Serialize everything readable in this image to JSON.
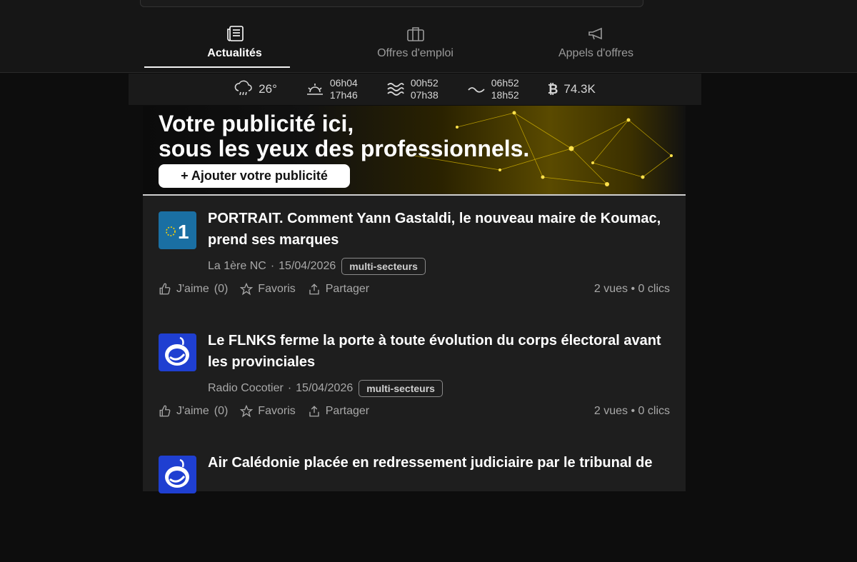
{
  "tabs": [
    {
      "label": "Actualités",
      "icon": "newspaper-icon",
      "active": true
    },
    {
      "label": "Offres d'emploi",
      "icon": "briefcase-icon",
      "active": false
    },
    {
      "label": "Appels d'offres",
      "icon": "megaphone-icon",
      "active": false
    }
  ],
  "weather": {
    "temperature": "26°",
    "sunrise": "06h04",
    "sunset": "17h46",
    "high_tide": "00h52",
    "high_tide_2": "07h38",
    "low_tide": "06h52",
    "low_tide_2": "18h52",
    "bitcoin": "74.3K"
  },
  "banner": {
    "line1": "Votre publicité ici,",
    "line2": "sous les yeux des professionnels.",
    "button": "+ Ajouter votre publicité"
  },
  "articles": [
    {
      "title": "PORTRAIT. Comment Yann Gastaldi, le nouveau maire de Koumac, prend ses marques",
      "source": "La 1ère NC",
      "date": "15/04/2026",
      "tag": "multi-secteurs",
      "like": "J'aime",
      "like_count": "(0)",
      "favoris": "Favoris",
      "share": "Partager",
      "stats": "2 vues • 0 clics"
    },
    {
      "title": "Le FLNKS ferme la porte à toute évolution du corps électoral avant les provinciales",
      "source": "Radio Cocotier",
      "date": "15/04/2026",
      "tag": "multi-secteurs",
      "like": "J'aime",
      "like_count": "(0)",
      "favoris": "Favoris",
      "share": "Partager",
      "stats": "2 vues • 0 clics"
    },
    {
      "title": "Air Calédonie placée en redressement judiciaire par le tribunal de"
    }
  ],
  "colors": {
    "accent": "#ffffff",
    "la1ere_logo": "#1a6fa3",
    "cocotier_logo": "#1f3fd1"
  }
}
